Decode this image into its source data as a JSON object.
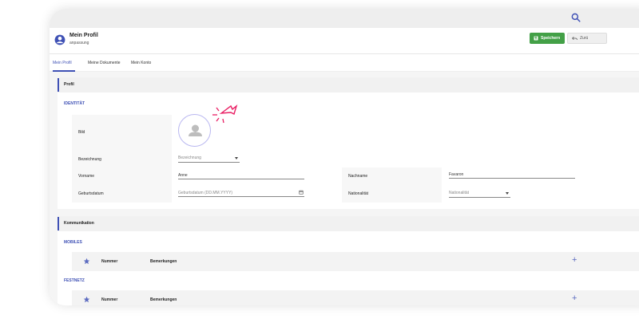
{
  "header": {
    "title": "Mein Profil",
    "subtitle": "anpassung",
    "save_label": "Speichern",
    "reset_label": "Zurü"
  },
  "tabs": [
    {
      "label": "Mein Profil",
      "active": true
    },
    {
      "label": "Meine Dokumente",
      "active": false
    },
    {
      "label": "Mein Konto",
      "active": false
    }
  ],
  "profile": {
    "section_label": "Profil",
    "group_label": "IDENTITÄT",
    "photo_label": "Bild",
    "title_label": "Bezeichnung",
    "title_placeholder": "Bezeichnung",
    "firstname_label": "Vorname",
    "firstname_value": "Anne",
    "lastname_label": "Nachname",
    "lastname_value": "Favaron",
    "birthdate_label": "Geburtsdatum",
    "birthdate_placeholder": "Geburtsdatum (DD.MM.YYYY)",
    "nationality_label": "Nationalität",
    "nationality_placeholder": "Nationalität"
  },
  "communication": {
    "section_label": "Kommunikation",
    "mobile": {
      "group_label": "MOBILES",
      "col_number": "Nummer",
      "col_notes": "Bemerkungen"
    },
    "landline": {
      "group_label": "FESTNETZ",
      "col_number": "Nummer",
      "col_notes": "Bemerkungen"
    }
  },
  "colors": {
    "accent": "#3f51b5",
    "save": "#43a047",
    "click_marker": "#e91e63"
  },
  "icons": [
    "search-icon",
    "account-circle-icon",
    "save-icon",
    "undo-icon",
    "person-icon",
    "calendar-icon",
    "chevron-down-icon",
    "star-icon",
    "plus-icon",
    "click-cursor-icon"
  ]
}
